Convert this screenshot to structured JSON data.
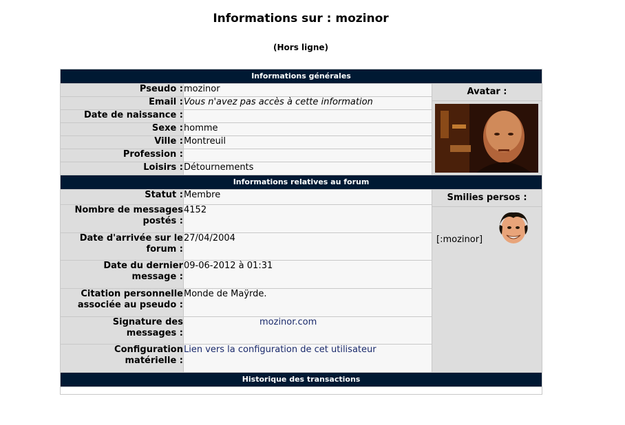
{
  "header": {
    "title": "Informations sur : mozinor",
    "status": "(Hors ligne)"
  },
  "sections": {
    "general": "Informations générales",
    "forum": "Informations relatives au forum",
    "history": "Historique des transactions"
  },
  "general": {
    "pseudo_label": "Pseudo :",
    "pseudo_value": "mozinor",
    "email_label": "Email :",
    "email_value": "Vous n'avez pas accès à cette information",
    "birth_label": "Date de naissance :",
    "birth_value": "",
    "sex_label": "Sexe :",
    "sex_value": "homme",
    "city_label": "Ville :",
    "city_value": "Montreuil",
    "job_label": "Profession :",
    "job_value": "",
    "hobby_label": "Loisirs :",
    "hobby_value": "Détournements",
    "avatar_label": "Avatar :"
  },
  "forum": {
    "status_label": "Statut :",
    "status_value": "Membre",
    "messages_label": "Nombre de messages postés :",
    "messages_value": "4152",
    "arrival_label": "Date d'arrivée sur le forum :",
    "arrival_value": "27/04/2004",
    "last_label": "Date du dernier message :",
    "last_value": "09-06-2012 à 01:31",
    "quote_label": "Citation personnelle associée au pseudo :",
    "quote_value": "Monde de Maÿrde.",
    "signature_label": "Signature des messages :",
    "signature_value": "mozinor.com",
    "config_label": "Configuration matérielle :",
    "config_value": "Lien vers la configuration de cet utilisateur",
    "smilies_label": "Smilies persos :",
    "smiley_code": "[:mozinor]"
  },
  "colors": {
    "header_bg": "#001933",
    "label_bg": "#dddddd",
    "value_bg": "#f7f7f7",
    "link": "#1a2a6c"
  }
}
